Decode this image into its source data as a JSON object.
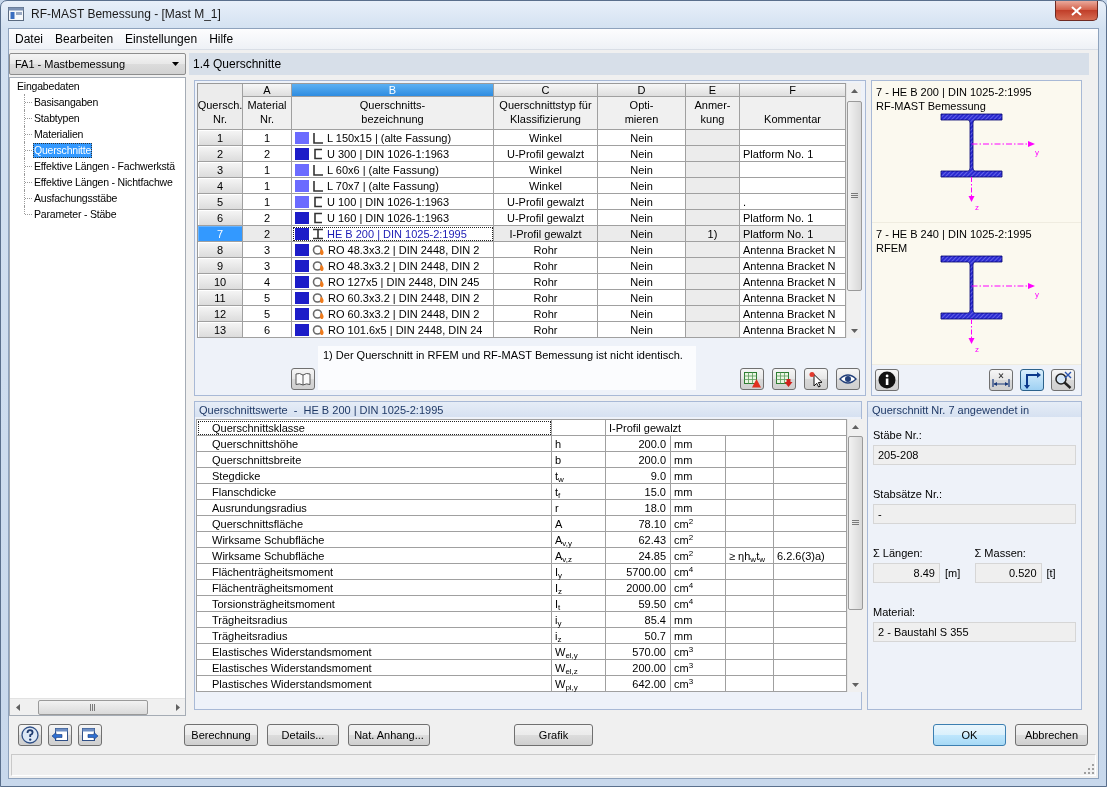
{
  "window": {
    "title": "RF-MAST Bemessung - [Mast M_1]"
  },
  "menu": [
    {
      "label": "Datei"
    },
    {
      "label": "Bearbeiten"
    },
    {
      "label": "Einstellungen"
    },
    {
      "label": "Hilfe"
    }
  ],
  "sidebar": {
    "case_dropdown": "FA1 - Mastbemessung",
    "tree": [
      {
        "label": "Eingabedaten",
        "selected": false,
        "children": [
          {
            "label": "Basisangaben",
            "selected": false
          },
          {
            "label": "Stabtypen",
            "selected": false
          },
          {
            "label": "Materialien",
            "selected": false
          },
          {
            "label": "Querschnitte",
            "selected": true
          },
          {
            "label": "Effektive Längen - Fachwerkstä",
            "selected": false
          },
          {
            "label": "Effektive Längen - Nichtfachwe",
            "selected": false
          },
          {
            "label": "Ausfachungsstäbe",
            "selected": false
          },
          {
            "label": "Parameter - Stäbe",
            "selected": false
          }
        ]
      }
    ]
  },
  "page_header": "1.4 Querschnitte",
  "sections": {
    "column_letters": [
      {
        "label": "A",
        "selected": false
      },
      {
        "label": "B",
        "selected": true
      },
      {
        "label": "C",
        "selected": false
      },
      {
        "label": "D",
        "selected": false
      },
      {
        "label": "E",
        "selected": false
      },
      {
        "label": "F",
        "selected": false
      }
    ],
    "columns": [
      "Quersch.\nNr.",
      "Material\nNr.",
      "Querschnitts-\nbezeichnung",
      "Querschnittstyp für\nKlassifizierung",
      "Opti-\nmieren",
      "Anmer-\nkung",
      "Kommentar"
    ],
    "rows": [
      {
        "no": "1",
        "material": "1",
        "color": "#6b6bff",
        "kind": "angle",
        "designation": "L 150x15 | (alte Fassung)",
        "type": "Winkel",
        "optimize": "Nein",
        "selected": false
      },
      {
        "no": "2",
        "material": "2",
        "color": "#1c1cc8",
        "kind": "channel",
        "designation": "U 300 | DIN 1026-1:1963",
        "type": "U-Profil gewalzt",
        "optimize": "Nein",
        "comment": "Platform No. 1",
        "selected": false
      },
      {
        "no": "3",
        "material": "1",
        "color": "#6b6bff",
        "kind": "angle",
        "designation": "L 60x6 | (alte Fassung)",
        "type": "Winkel",
        "optimize": "Nein",
        "selected": false
      },
      {
        "no": "4",
        "material": "1",
        "color": "#6b6bff",
        "kind": "angle",
        "designation": "L 70x7 | (alte Fassung)",
        "type": "Winkel",
        "optimize": "Nein",
        "selected": false
      },
      {
        "no": "5",
        "material": "1",
        "color": "#6b6bff",
        "kind": "channel",
        "designation": "U 100 | DIN 1026-1:1963",
        "type": "U-Profil gewalzt",
        "optimize": "Nein",
        "comment": ".",
        "selected": false
      },
      {
        "no": "6",
        "material": "2",
        "color": "#1c1cc8",
        "kind": "channel",
        "designation": "U 160 | DIN 1026-1:1963",
        "type": "U-Profil gewalzt",
        "optimize": "Nein",
        "comment": "Platform No. 1",
        "selected": false
      },
      {
        "no": "7",
        "material": "2",
        "color": "#1c1cc8",
        "kind": "i_beam",
        "designation": "HE B 200 | DIN 1025-2:1995",
        "type": "I-Profil gewalzt",
        "optimize": "Nein",
        "note": "1)",
        "comment": "Platform No. 1",
        "selected": true
      },
      {
        "no": "8",
        "material": "3",
        "color": "#1c1cc8",
        "kind": "tube",
        "designation": "RO 48.3x3.2 | DIN 2448, DIN 2",
        "type": "Rohr",
        "optimize": "Nein",
        "comment": "Antenna Bracket N",
        "selected": false
      },
      {
        "no": "9",
        "material": "3",
        "color": "#1c1cc8",
        "kind": "tube",
        "designation": "RO 48.3x3.2 | DIN 2448, DIN 2",
        "type": "Rohr",
        "optimize": "Nein",
        "comment": "Antenna Bracket N",
        "selected": false
      },
      {
        "no": "10",
        "material": "4",
        "color": "#1c1cc8",
        "kind": "tube",
        "designation": "RO 127x5 | DIN 2448, DIN 245",
        "type": "Rohr",
        "optimize": "Nein",
        "comment": "Antenna Bracket N",
        "selected": false
      },
      {
        "no": "11",
        "material": "5",
        "color": "#1c1cc8",
        "kind": "tube",
        "designation": "RO 60.3x3.2 | DIN 2448, DIN 2",
        "type": "Rohr",
        "optimize": "Nein",
        "comment": "Antenna Bracket N",
        "selected": false
      },
      {
        "no": "12",
        "material": "5",
        "color": "#1c1cc8",
        "kind": "tube",
        "designation": "RO 60.3x3.2 | DIN 2448, DIN 2",
        "type": "Rohr",
        "optimize": "Nein",
        "comment": "Antenna Bracket N",
        "selected": false
      },
      {
        "no": "13",
        "material": "6",
        "color": "#1c1cc8",
        "kind": "tube",
        "designation": "RO 101.6x5 | DIN 2448, DIN 24",
        "type": "Rohr",
        "optimize": "Nein",
        "comment": "Antenna Bracket N",
        "selected": false
      }
    ]
  },
  "footnote": "1) Der Querschnitt in RFEM und RF-MAST Bemessung ist nicht identisch.",
  "previews": [
    {
      "title": "7 - HE B 200 | DIN 1025-2:1995",
      "source": "RF-MAST Bemessung",
      "y_axis": "y",
      "z_axis": "z"
    },
    {
      "title": "7 - HE B 240 | DIN 1025-2:1995",
      "source": "RFEM",
      "y_axis": "y",
      "z_axis": "z"
    }
  ],
  "preview_tools": [
    {
      "kind": "info",
      "on": false
    },
    {
      "kind": "dimension",
      "on": false
    },
    {
      "kind": "axes",
      "on": true
    },
    {
      "kind": "zoom",
      "on": false
    }
  ],
  "properties": {
    "title": "Querschnittswerte  -  HE B 200 | DIN 1025-2:1995",
    "rows": [
      {
        "kind": "text",
        "name": "Querschnittsklasse",
        "value": "I-Profil gewalzt",
        "selected": true
      },
      {
        "kind": "value",
        "name": "Querschnittshöhe",
        "symbol": "h",
        "value": "200.0",
        "unit": "mm",
        "selected": false
      },
      {
        "kind": "value",
        "name": "Querschnittsbreite",
        "symbol": "b",
        "value": "200.0",
        "unit": "mm",
        "selected": false
      },
      {
        "kind": "value",
        "name": "Stegdicke",
        "symbol": "t$_{w}$",
        "value": "9.0",
        "unit": "mm",
        "selected": false
      },
      {
        "kind": "value",
        "name": "Flanschdicke",
        "symbol": "t$_{f}$",
        "value": "15.0",
        "unit": "mm",
        "selected": false
      },
      {
        "kind": "value",
        "name": "Ausrundungsradius",
        "symbol": "r",
        "value": "18.0",
        "unit": "mm",
        "selected": false
      },
      {
        "kind": "value",
        "name": "Querschnittsfläche",
        "symbol": "A",
        "value": "78.10",
        "unit": "cm$^{2}$",
        "selected": false
      },
      {
        "kind": "value",
        "name": "Wirksame Schubfläche",
        "symbol": "A$_{v,y}$",
        "value": "62.43",
        "unit": "cm$^{2}$",
        "selected": false
      },
      {
        "kind": "value",
        "name": "Wirksame Schubfläche",
        "symbol": "A$_{v,z}$",
        "value": "24.85",
        "unit": "cm$^{2}$",
        "condition": "≥ ηh$_{w}$t$_{w}$",
        "reference": "6.2.6(3)a)",
        "selected": false
      },
      {
        "kind": "value",
        "name": "Flächenträgheitsmoment",
        "symbol": "I$_{y}$",
        "value": "5700.00",
        "unit": "cm$^{4}$",
        "selected": false
      },
      {
        "kind": "value",
        "name": "Flächenträgheitsmoment",
        "symbol": "I$_{z}$",
        "value": "2000.00",
        "unit": "cm$^{4}$",
        "selected": false
      },
      {
        "kind": "value",
        "name": "Torsionsträgheitsmoment",
        "symbol": "I$_{t}$",
        "value": "59.50",
        "unit": "cm$^{4}$",
        "selected": false
      },
      {
        "kind": "value",
        "name": "Trägheitsradius",
        "symbol": "i$_{y}$",
        "value": "85.4",
        "unit": "mm",
        "selected": false
      },
      {
        "kind": "value",
        "name": "Trägheitsradius",
        "symbol": "i$_{z}$",
        "value": "50.7",
        "unit": "mm",
        "selected": false
      },
      {
        "kind": "value",
        "name": "Elastisches Widerstandsmoment",
        "symbol": "W$_{el,y}$",
        "value": "570.00",
        "unit": "cm$^{3}$",
        "selected": false
      },
      {
        "kind": "value",
        "name": "Elastisches Widerstandsmoment",
        "symbol": "W$_{el,z}$",
        "value": "200.00",
        "unit": "cm$^{3}$",
        "selected": false
      },
      {
        "kind": "value",
        "name": "Plastisches Widerstandsmoment",
        "symbol": "W$_{pl,y}$",
        "value": "642.00",
        "unit": "cm$^{3}$",
        "selected": false
      }
    ]
  },
  "usage": {
    "title": "Querschnitt Nr. 7 angewendet in",
    "members": {
      "label": "Stäbe Nr.:",
      "value": "205-208"
    },
    "member_sets": {
      "label": "Stabsätze Nr.:",
      "value": "-"
    },
    "total_length": {
      "label": "Σ Längen:",
      "value": "8.49",
      "unit": "[m]"
    },
    "total_mass": {
      "label": "Σ Massen:",
      "value": "0.520",
      "unit": "[t]"
    },
    "material": {
      "label": "Material:",
      "value": "2 - Baustahl S 355"
    }
  },
  "actions": [
    {
      "label": "Berechnung"
    },
    {
      "label": "Details..."
    },
    {
      "label": "Nat. Anhang..."
    },
    {
      "label": "Grafik"
    }
  ],
  "dialog_buttons": [
    {
      "label": "OK",
      "default": true
    },
    {
      "label": "Abbrechen",
      "default": false
    }
  ]
}
